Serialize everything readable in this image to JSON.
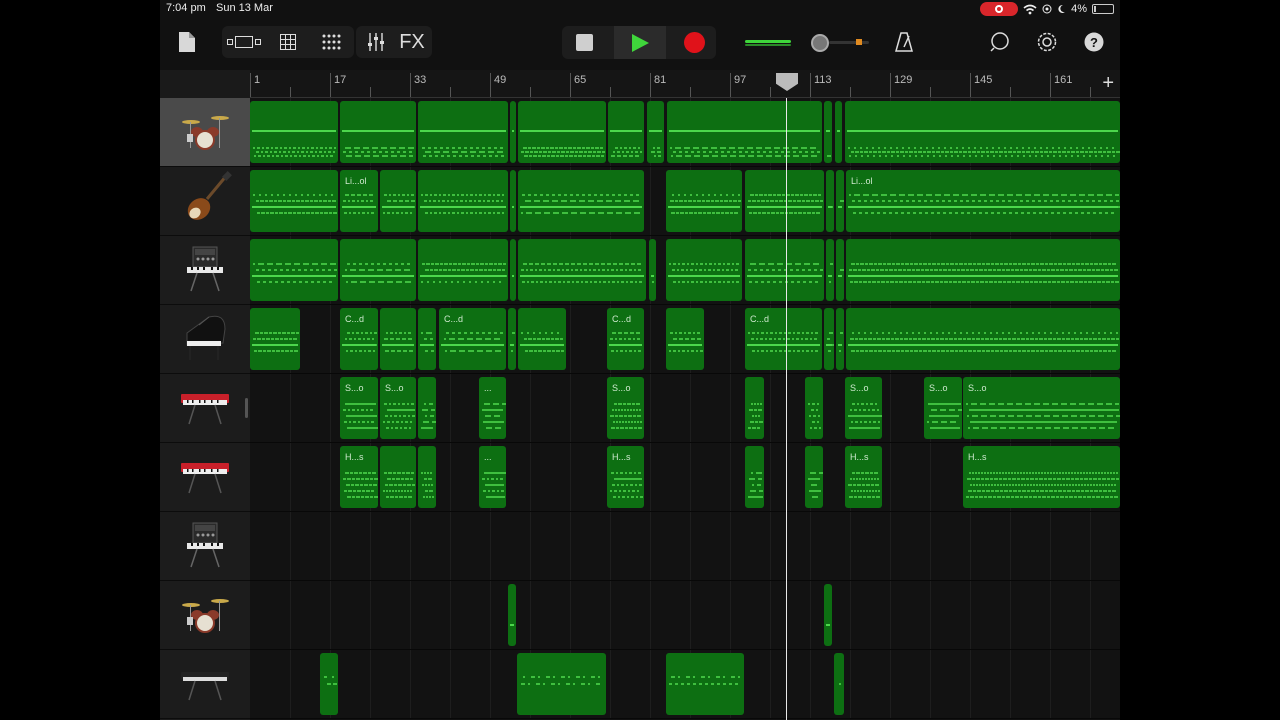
{
  "status_bar": {
    "time": "7:04 pm",
    "date": "Sun 13 Mar",
    "battery": "4%"
  },
  "toolbar": {
    "fx_label": "FX",
    "icons": [
      "document-icon",
      "tracks-view-icon",
      "grid-view-icon",
      "dots-grid-icon",
      "mixer-icon",
      "stop-icon",
      "play-icon",
      "record-icon",
      "metronome-icon",
      "loop-icon",
      "settings-icon",
      "help-icon"
    ]
  },
  "ruler": {
    "bars": [
      "1",
      "17",
      "33",
      "49",
      "65",
      "81",
      "97",
      "113",
      "129",
      "145",
      "161"
    ],
    "add_label": "+"
  },
  "colors": {
    "region": "#0d6f12",
    "notes": "#4cd74c",
    "play": "#3fd63b",
    "record": "#e0121a"
  },
  "tracks": [
    {
      "instrument": "drum-kit",
      "selected": true
    },
    {
      "instrument": "bass-guitar",
      "selected": false
    },
    {
      "instrument": "synth-module",
      "selected": false
    },
    {
      "instrument": "grand-piano",
      "selected": false
    },
    {
      "instrument": "red-keyboard",
      "selected": false
    },
    {
      "instrument": "red-keyboard",
      "selected": false
    },
    {
      "instrument": "synth-module",
      "selected": false
    },
    {
      "instrument": "drum-kit",
      "selected": false
    },
    {
      "instrument": "black-keyboard",
      "selected": false
    }
  ],
  "region_labels": {
    "bass": "Li...ol",
    "piano": "C...d",
    "keys_a": "S...o",
    "keys_b": "H...s",
    "short": "..."
  }
}
